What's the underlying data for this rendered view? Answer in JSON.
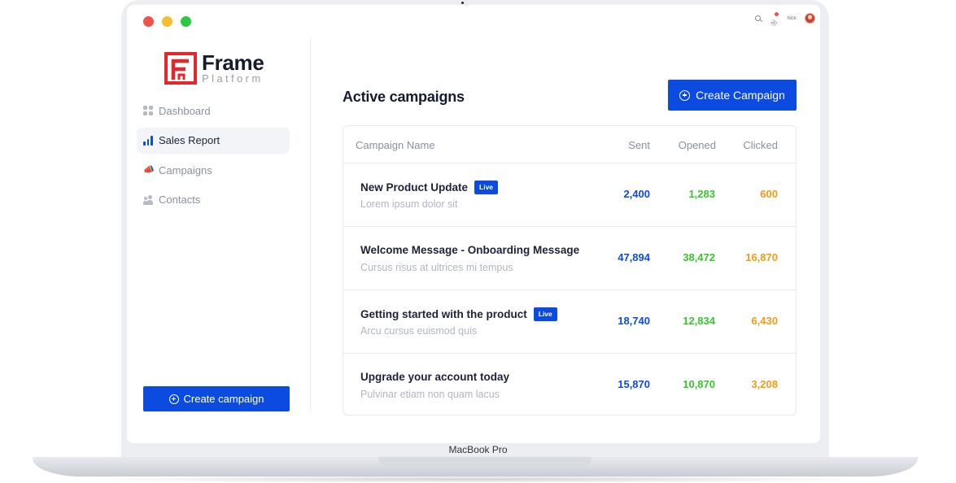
{
  "device": {
    "label": "MacBook Pro"
  },
  "topbar": {
    "user_name": "Nick"
  },
  "brand": {
    "name": "Frame",
    "sub": "Platform",
    "color": "#e8252b"
  },
  "sidebar": {
    "items": [
      {
        "label": "Dashboard",
        "icon": "grid-icon",
        "active": false
      },
      {
        "label": "Sales Report",
        "icon": "bar-chart-icon",
        "active": true
      },
      {
        "label": "Campaigns",
        "icon": "megaphone-icon",
        "active": false
      },
      {
        "label": "Contacts",
        "icon": "contacts-icon",
        "active": false
      }
    ],
    "create_label": "Create campaign"
  },
  "main": {
    "title": "Active campaigns",
    "create_label": "Create Campaign",
    "columns": [
      "Campaign Name",
      "Sent",
      "Opened",
      "Clicked"
    ],
    "rows": [
      {
        "name": "New Product Update",
        "badge": "Live",
        "sub": "Lorem ipsum dolor sit",
        "sent": "2,400",
        "opened": "1,283",
        "clicked": "600"
      },
      {
        "name": "Welcome Message - Onboarding Message",
        "badge": "",
        "sub": "Cursus risus at ultrices mi tempus",
        "sent": "47,894",
        "opened": "38,472",
        "clicked": "16,870"
      },
      {
        "name": "Getting started with the product",
        "badge": "Live",
        "sub": "Arcu cursus euismod quis",
        "sent": "18,740",
        "opened": "12,834",
        "clicked": "6,430"
      },
      {
        "name": "Upgrade your account today",
        "badge": "",
        "sub": "Pulvinar etiam non quam lacus",
        "sent": "15,870",
        "opened": "10,870",
        "clicked": "3,208"
      }
    ]
  },
  "colors": {
    "accent": "#0b4be0",
    "sent": "#0b4be0",
    "opened": "#35c72b",
    "clicked": "#f59a16"
  }
}
